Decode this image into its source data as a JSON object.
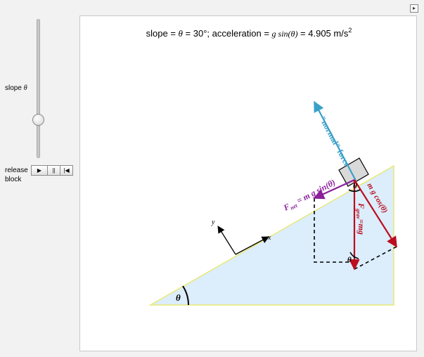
{
  "controls": {
    "slope_label": "slope",
    "slope_symbol": "θ",
    "release_label_line1": "release",
    "release_label_line2": "block",
    "play_glyph": "▶",
    "pause_glyph": "||",
    "reset_glyph": "|◀",
    "expand_glyph": "▸",
    "slope_fraction": 0.75
  },
  "plot": {
    "title_part1": "slope = ",
    "title_theta": "θ",
    "title_part2": " = 30°;  acceleration = ",
    "title_formula": "g sin(θ)",
    "title_part3": " = 4.905 m/s",
    "title_sup": "2",
    "labels": {
      "normal": "\"normal\" force",
      "fnet": "F",
      "fnet_sub": "net",
      "fnet_rhs": " = m g sin(θ)",
      "mgcos": "m g cos(θ)",
      "fgrav": "F",
      "fgrav_sub": "grav",
      "fgrav_rhs": "=mg",
      "theta_block": "θ",
      "theta_bottom": "θ",
      "theta_base": "θ",
      "axis_x": "x",
      "axis_y": "y"
    },
    "colors": {
      "normal": "#3aa0c8",
      "fnet": "#8a1f9a",
      "gravity": "#bb0e1e",
      "incline_fill": "#dcedfb",
      "incline_edge": "#e8e878"
    }
  }
}
